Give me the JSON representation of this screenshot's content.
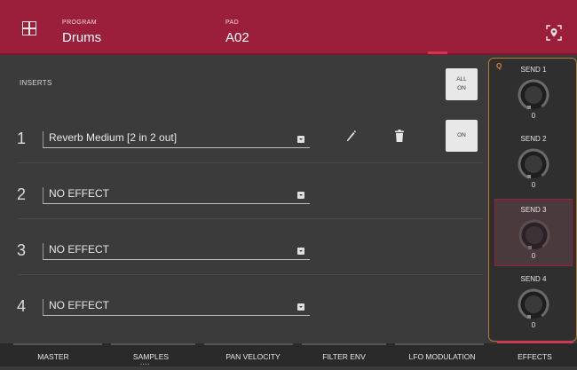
{
  "header": {
    "program_label": "PROGRAM",
    "program_value": "Drums",
    "pad_label": "PAD",
    "pad_value": "A02",
    "grid_icon": "grid-icon",
    "locate_icon": "location-focus-icon",
    "accent_color": "#9b1e3a"
  },
  "inserts": {
    "title": "INSERTS",
    "all_on_line1": "ALL",
    "all_on_line2": "ON",
    "rows": [
      {
        "num": "1",
        "effect": "Reverb Medium [2 in 2 out]",
        "on_label": "ON"
      },
      {
        "num": "2",
        "effect": "NO EFFECT"
      },
      {
        "num": "3",
        "effect": "NO EFFECT"
      },
      {
        "num": "4",
        "effect": "NO EFFECT"
      }
    ]
  },
  "sends": {
    "q_label": "Q",
    "items": [
      {
        "label": "SEND 1",
        "value": "0"
      },
      {
        "label": "SEND 2",
        "value": "0"
      },
      {
        "label": "SEND 3",
        "value": "0",
        "active": true
      },
      {
        "label": "SEND 4",
        "value": "0"
      }
    ],
    "panel_border_color": "#b87d2f"
  },
  "tabs": [
    {
      "label": "MASTER"
    },
    {
      "label": "SAMPLES"
    },
    {
      "label": "PAN VELOCITY"
    },
    {
      "label": "FILTER ENV"
    },
    {
      "label": "LFO MODULATION"
    },
    {
      "label": "EFFECTS",
      "active": true
    }
  ]
}
